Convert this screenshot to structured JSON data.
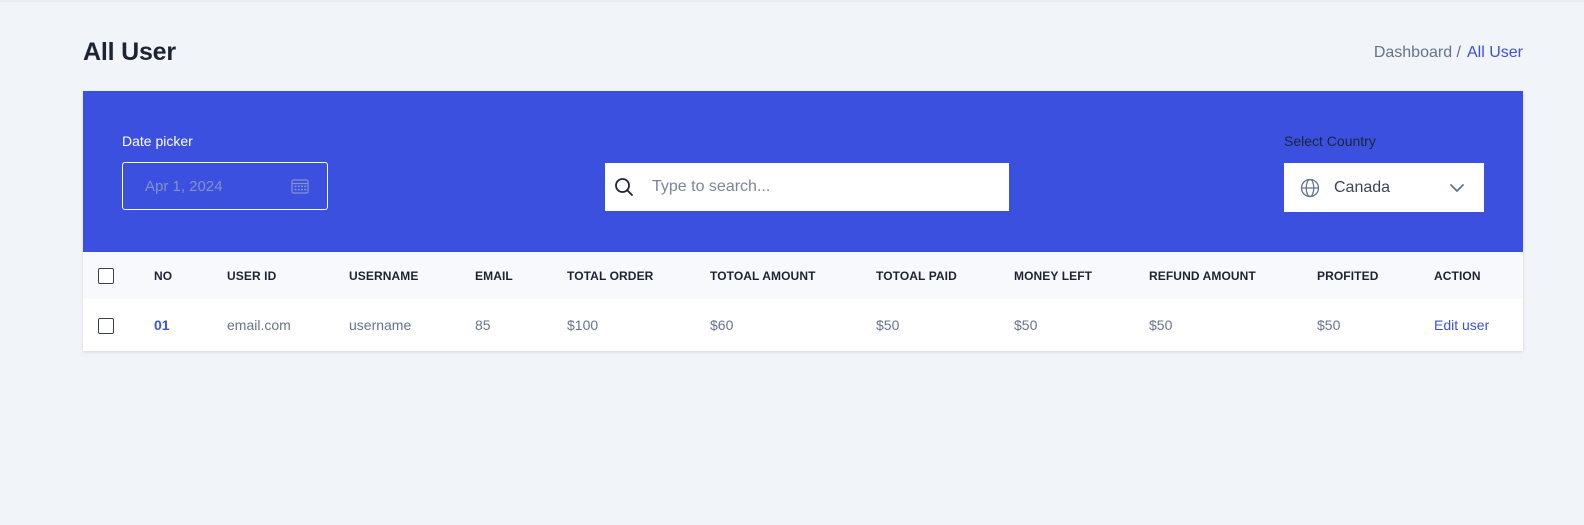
{
  "header": {
    "title": "All User",
    "breadcrumb": {
      "parent": "Dashboard /",
      "current": "All User"
    }
  },
  "filters": {
    "date_label": "Date picker",
    "date_placeholder": "Apr 1, 2024",
    "search_placeholder": "Type to search...",
    "country_label": "Select Country",
    "country_value": "Canada"
  },
  "table": {
    "columns": [
      "NO",
      "USER ID",
      "USERNAME",
      "EMAIL",
      "TOTAL ORDER",
      "TOTOAL AMOUNT",
      "TOTOAL PAID",
      "MONEY LEFT",
      "REFUND AMOUNT",
      "PROFITED",
      "ACTION"
    ],
    "rows": [
      {
        "no": "01",
        "user_id": "email.com",
        "username": "username",
        "email": "85",
        "total_order": "$100",
        "total_amount": "$60",
        "total_paid": "$50",
        "money_left": "$50",
        "refund_amount": "$50",
        "profited": "$50",
        "action": "Edit user"
      }
    ]
  },
  "colors": {
    "accent": "#3c50e0",
    "background": "#f1f4f8",
    "text": "#1c2434",
    "muted": "#64748b"
  }
}
